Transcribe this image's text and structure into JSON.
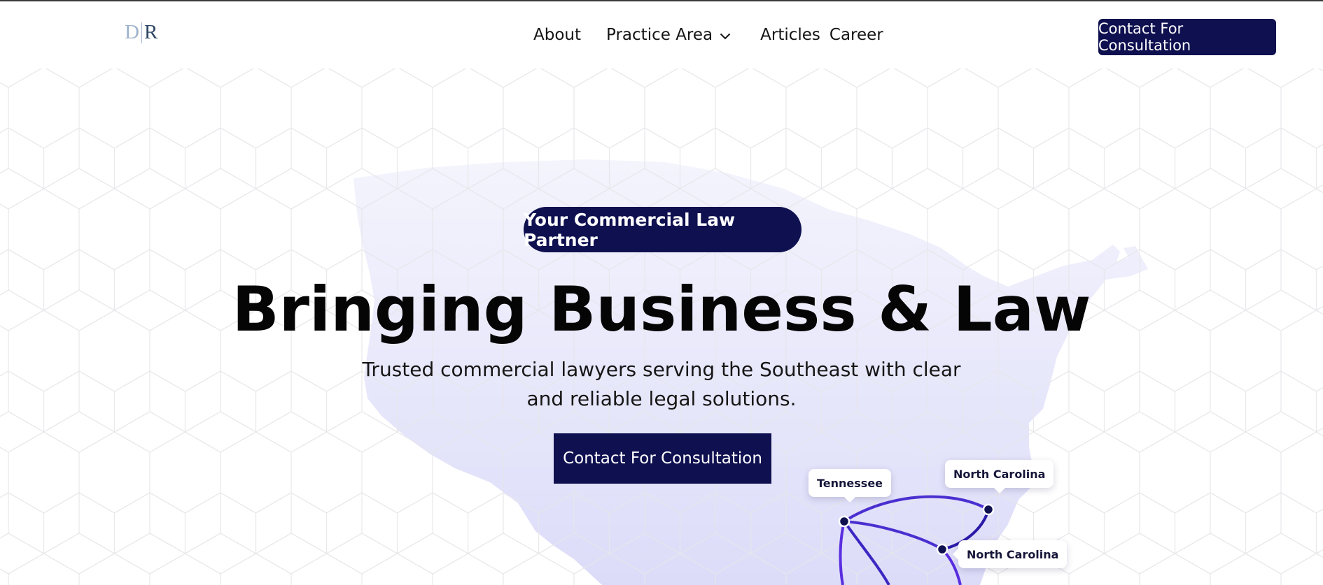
{
  "header": {
    "logo": {
      "left": "D",
      "right": "R"
    },
    "nav": {
      "about": "About",
      "practice_area": "Practice Area",
      "articles": "Articles",
      "career": "Career"
    },
    "cta_label": "Contact For Consultation"
  },
  "hero": {
    "badge": "Your Commercial Law Partner",
    "title": "Bringing Business & Law",
    "subtitle_line1": "Trusted commercial lawyers serving the Southeast with clear",
    "subtitle_line2": "and reliable legal solutions.",
    "cta_label": "Contact For Consultation"
  },
  "map": {
    "labels": {
      "tennessee": "Tennessee",
      "north_carolina_top": "North Carolina",
      "north_carolina_side": "North Carolina"
    }
  },
  "colors": {
    "brand_navy": "#0f1050",
    "route_purple": "#5a2ee0",
    "map_fill": "#e7e7fb"
  }
}
